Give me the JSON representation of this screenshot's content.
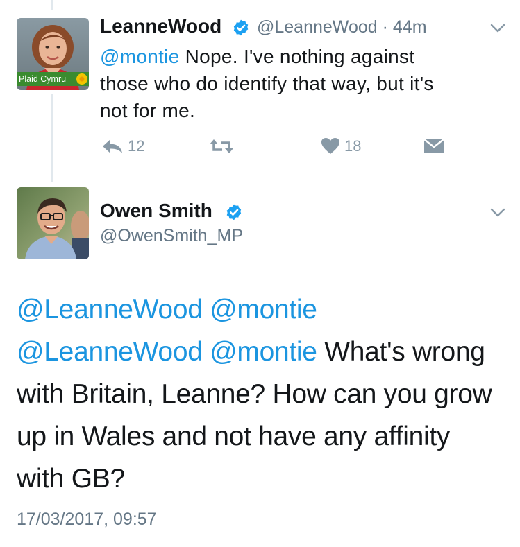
{
  "tweet1": {
    "avatar_badge": "Plaid Cymru",
    "display_name": "LeanneWood",
    "handle": "@LeanneWood",
    "separator": "·",
    "time": "44m",
    "body_mention": "@montie",
    "body_line1": " Nope. I've nothing against",
    "body_line2": "those who do identify that way, but it's",
    "body_line3": "not for me.",
    "reply_count": "12",
    "like_count": "18"
  },
  "tweet2": {
    "display_name": "Owen Smith",
    "handle": "@OwenSmith_MP",
    "line1_mentions": "@LeanneWood @montie",
    "line2_mentions": "@LeanneWood @montie",
    "line2_text": " What's wrong",
    "line3": "with Britain, Leanne? How can you grow",
    "line4": "up in Wales and not have any affinity",
    "line5": "with GB?",
    "timestamp": "17/03/2017, 09:57"
  },
  "colors": {
    "link": "#1b95e0",
    "secondary_text": "#657786",
    "action_icon": "#8899a6",
    "verified": "#1da1f2",
    "thread_line": "#e1e8ed",
    "plaid_green": "#3a8b2f",
    "plaid_yellow": "#f2c500"
  },
  "icons": {
    "reply": "reply-icon",
    "retweet": "retweet-icon",
    "like": "heart-icon",
    "dm": "envelope-icon",
    "verified": "verified-badge-icon",
    "menu": "chevron-down-icon"
  }
}
